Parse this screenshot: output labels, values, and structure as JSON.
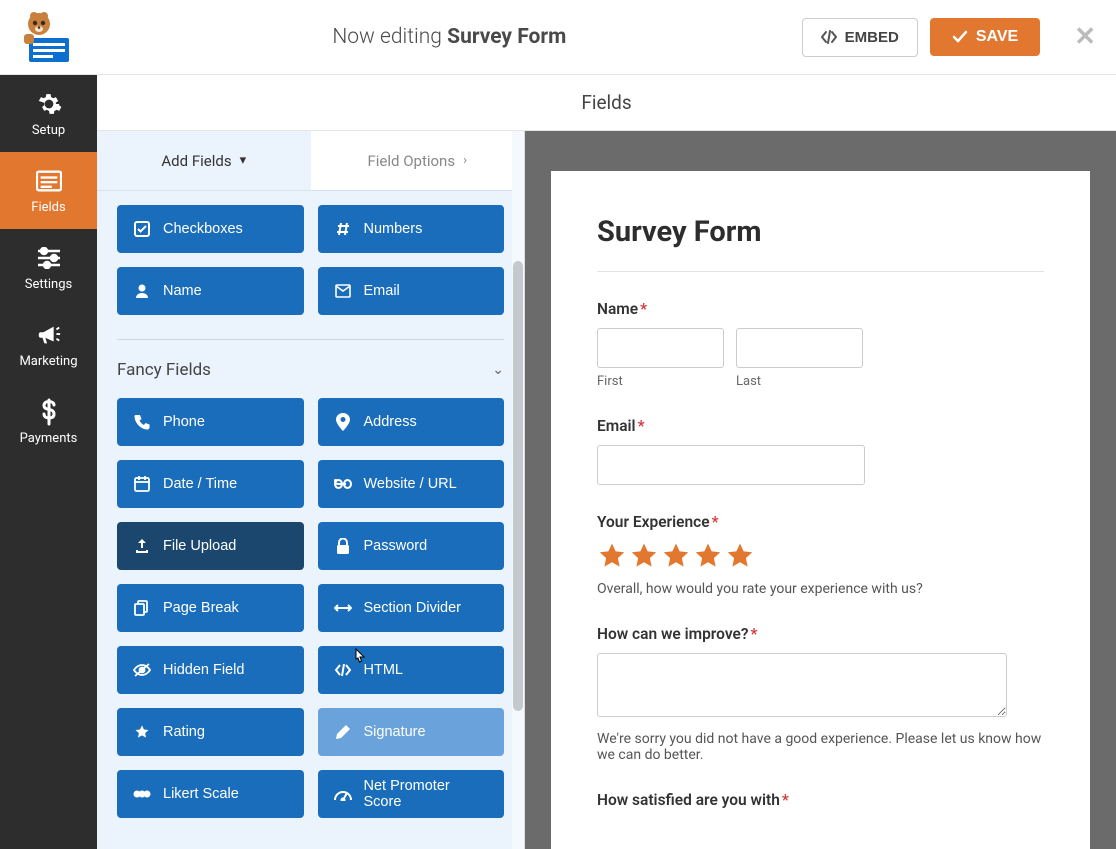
{
  "header": {
    "editing_prefix": "Now editing",
    "form_name": "Survey Form",
    "embed_label": "EMBED",
    "save_label": "SAVE"
  },
  "nav": {
    "items": [
      {
        "label": "Setup",
        "icon": "gear-icon"
      },
      {
        "label": "Fields",
        "icon": "list-icon",
        "active": true
      },
      {
        "label": "Settings",
        "icon": "sliders-icon"
      },
      {
        "label": "Marketing",
        "icon": "bullhorn-icon"
      },
      {
        "label": "Payments",
        "icon": "dollar-icon"
      }
    ]
  },
  "sub_header": "Fields",
  "sidebar": {
    "tabs": {
      "add": "Add Fields",
      "options": "Field Options"
    },
    "standard_fields": [
      {
        "label": "Checkboxes",
        "icon": "check-square-icon"
      },
      {
        "label": "Numbers",
        "icon": "hash-icon"
      },
      {
        "label": "Name",
        "icon": "user-icon"
      },
      {
        "label": "Email",
        "icon": "envelope-icon"
      }
    ],
    "fancy_title": "Fancy Fields",
    "fancy_fields": [
      {
        "label": "Phone",
        "icon": "phone-icon"
      },
      {
        "label": "Address",
        "icon": "map-pin-icon"
      },
      {
        "label": "Date / Time",
        "icon": "calendar-icon"
      },
      {
        "label": "Website / URL",
        "icon": "link-icon"
      },
      {
        "label": "File Upload",
        "icon": "upload-icon",
        "hover": true
      },
      {
        "label": "Password",
        "icon": "lock-icon"
      },
      {
        "label": "Page Break",
        "icon": "files-icon"
      },
      {
        "label": "Section Divider",
        "icon": "arrows-h-icon"
      },
      {
        "label": "Hidden Field",
        "icon": "eye-slash-icon"
      },
      {
        "label": "HTML",
        "icon": "code-icon"
      },
      {
        "label": "Rating",
        "icon": "star-icon"
      },
      {
        "label": "Signature",
        "icon": "pencil-icon",
        "disabled": true
      },
      {
        "label": "Likert Scale",
        "icon": "ellipsis-icon"
      },
      {
        "label": "Net Promoter Score",
        "icon": "dashboard-icon"
      }
    ]
  },
  "preview": {
    "title": "Survey Form",
    "name": {
      "label": "Name",
      "first": "First",
      "last": "Last"
    },
    "email": {
      "label": "Email"
    },
    "experience": {
      "label": "Your Experience",
      "help": "Overall, how would you rate your experience with us?"
    },
    "improve": {
      "label": "How can we improve?",
      "help": "We're sorry you did not have a good experience. Please let us know how we can do better."
    },
    "satisfied": {
      "label": "How satisfied are you with"
    }
  },
  "colors": {
    "accent": "#e27730",
    "primary": "#1a6dbb"
  }
}
